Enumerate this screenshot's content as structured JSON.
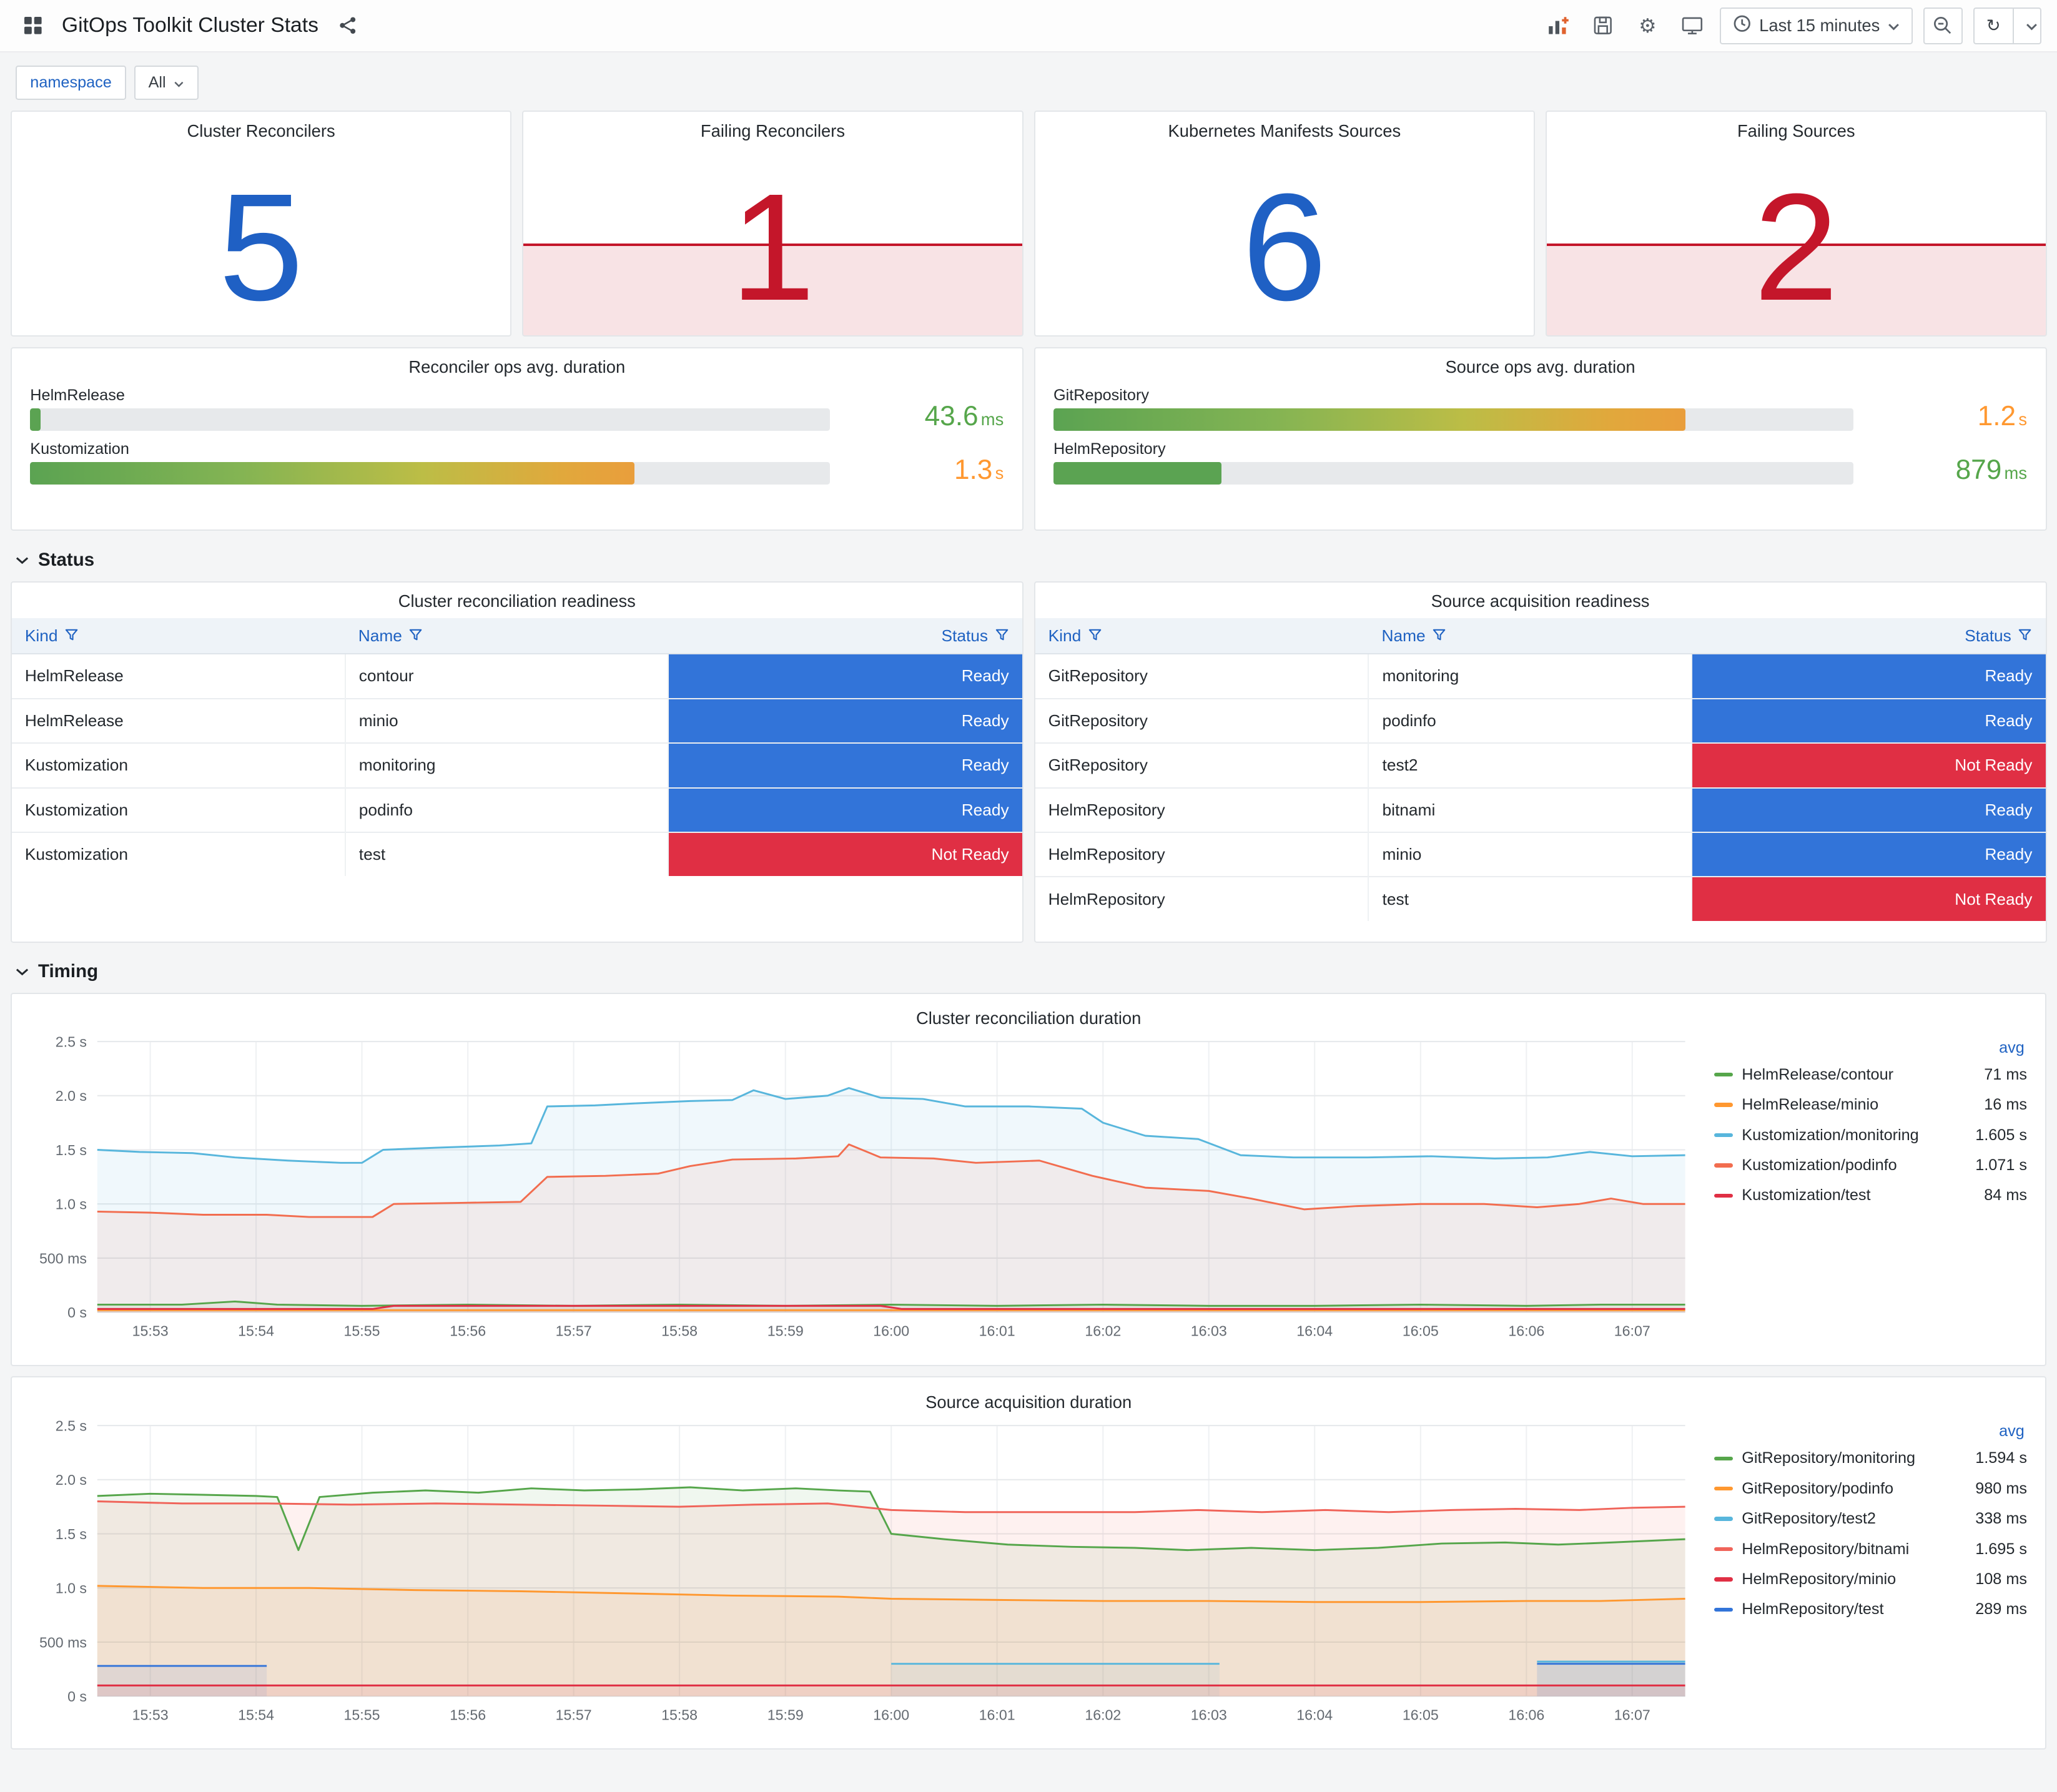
{
  "header": {
    "title": "GitOps Toolkit Cluster Stats",
    "time_range": "Last 15 minutes"
  },
  "filters": {
    "namespace_label": "namespace",
    "namespace_value": "All"
  },
  "colors": {
    "stat_ok": "#1f60c4",
    "stat_alert": "#c4162a",
    "alert_fill": "rgba(196,22,42,0.12)",
    "status_ready": "#3274d9",
    "status_not_ready": "#e02f44",
    "value_green": "#56a64b",
    "value_orange": "#ff9830",
    "link_blue": "#1f62c2"
  },
  "stats": [
    {
      "title": "Cluster Reconcilers",
      "value": "5",
      "state": "ok"
    },
    {
      "title": "Failing Reconcilers",
      "value": "1",
      "state": "alert"
    },
    {
      "title": "Kubernetes Manifests Sources",
      "value": "6",
      "state": "ok"
    },
    {
      "title": "Failing Sources",
      "value": "2",
      "state": "alert"
    }
  ],
  "gauges": [
    {
      "title": "Reconciler ops avg. duration",
      "rows": [
        {
          "label": "HelmRelease",
          "value": "43.6",
          "unit": "ms",
          "pct": 1.3,
          "fill": "green",
          "value_color": "green"
        },
        {
          "label": "Kustomization",
          "value": "1.3",
          "unit": "s",
          "pct": 75.5,
          "fill": "gradient",
          "value_color": "orange"
        }
      ]
    },
    {
      "title": "Source ops avg. duration",
      "rows": [
        {
          "label": "GitRepository",
          "value": "1.2",
          "unit": "s",
          "pct": 79,
          "fill": "gradient",
          "value_color": "orange"
        },
        {
          "label": "HelmRepository",
          "value": "879",
          "unit": "ms",
          "pct": 21,
          "fill": "green",
          "value_color": "green"
        }
      ]
    }
  ],
  "sections": {
    "status": "Status",
    "timing": "Timing"
  },
  "status_tables": [
    {
      "title": "Cluster reconciliation readiness",
      "columns": [
        "Kind",
        "Name",
        "Status"
      ],
      "rows": [
        [
          "HelmRelease",
          "contour",
          "Ready"
        ],
        [
          "HelmRelease",
          "minio",
          "Ready"
        ],
        [
          "Kustomization",
          "monitoring",
          "Ready"
        ],
        [
          "Kustomization",
          "podinfo",
          "Ready"
        ],
        [
          "Kustomization",
          "test",
          "Not Ready"
        ]
      ]
    },
    {
      "title": "Source acquisition readiness",
      "columns": [
        "Kind",
        "Name",
        "Status"
      ],
      "rows": [
        [
          "GitRepository",
          "monitoring",
          "Ready"
        ],
        [
          "GitRepository",
          "podinfo",
          "Ready"
        ],
        [
          "GitRepository",
          "test2",
          "Not Ready"
        ],
        [
          "HelmRepository",
          "bitnami",
          "Ready"
        ],
        [
          "HelmRepository",
          "minio",
          "Ready"
        ],
        [
          "HelmRepository",
          "test",
          "Not Ready"
        ]
      ]
    }
  ],
  "charts": [
    {
      "type": "line",
      "title": "Cluster reconciliation duration",
      "legend_header": "avg",
      "x_range": [
        0,
        15
      ],
      "y_range": [
        0,
        2.5
      ],
      "x_labels": [
        "15:53",
        "15:54",
        "15:55",
        "15:56",
        "15:57",
        "15:58",
        "15:59",
        "16:00",
        "16:01",
        "16:02",
        "16:03",
        "16:04",
        "16:05",
        "16:06",
        "16:07"
      ],
      "y_ticks": [
        {
          "v": 0,
          "label": "0 s"
        },
        {
          "v": 0.5,
          "label": "500 ms"
        },
        {
          "v": 1,
          "label": "1.0 s"
        },
        {
          "v": 1.5,
          "label": "1.5 s"
        },
        {
          "v": 2,
          "label": "2.0 s"
        },
        {
          "v": 2.5,
          "label": "2.5 s"
        }
      ],
      "series": [
        {
          "name": "HelmRelease/contour",
          "color": "#56a64b",
          "avg": "71 ms",
          "points": [
            [
              0,
              0.07
            ],
            [
              0.8,
              0.07
            ],
            [
              1.3,
              0.1
            ],
            [
              1.7,
              0.07
            ],
            [
              2.5,
              0.06
            ],
            [
              3.5,
              0.07
            ],
            [
              4.5,
              0.06
            ],
            [
              5.5,
              0.07
            ],
            [
              6.5,
              0.06
            ],
            [
              7.5,
              0.07
            ],
            [
              8.5,
              0.06
            ],
            [
              9.5,
              0.07
            ],
            [
              10.5,
              0.06
            ],
            [
              11.5,
              0.06
            ],
            [
              12.5,
              0.07
            ],
            [
              13.5,
              0.06
            ],
            [
              14.2,
              0.07
            ],
            [
              15,
              0.07
            ]
          ]
        },
        {
          "name": "HelmRelease/minio",
          "color": "#ff9830",
          "avg": "16 ms",
          "points": [
            [
              0,
              0.02
            ],
            [
              5,
              0.02
            ],
            [
              10,
              0.02
            ],
            [
              15,
              0.02
            ]
          ]
        },
        {
          "name": "Kustomization/monitoring",
          "color": "#58b6dc",
          "avg": "1.605 s",
          "points": [
            [
              0,
              1.5
            ],
            [
              0.4,
              1.48
            ],
            [
              0.9,
              1.47
            ],
            [
              1.3,
              1.43
            ],
            [
              1.8,
              1.4
            ],
            [
              2.3,
              1.38
            ],
            [
              2.5,
              1.38
            ],
            [
              2.7,
              1.5
            ],
            [
              3.2,
              1.52
            ],
            [
              3.8,
              1.54
            ],
            [
              4.1,
              1.56
            ],
            [
              4.25,
              1.9
            ],
            [
              4.7,
              1.91
            ],
            [
              5.1,
              1.93
            ],
            [
              5.6,
              1.95
            ],
            [
              6,
              1.96
            ],
            [
              6.2,
              2.05
            ],
            [
              6.5,
              1.97
            ],
            [
              6.9,
              2.0
            ],
            [
              7.1,
              2.07
            ],
            [
              7.4,
              1.98
            ],
            [
              7.8,
              1.97
            ],
            [
              8.2,
              1.9
            ],
            [
              8.8,
              1.9
            ],
            [
              9.3,
              1.88
            ],
            [
              9.5,
              1.75
            ],
            [
              9.9,
              1.63
            ],
            [
              10.4,
              1.6
            ],
            [
              10.8,
              1.45
            ],
            [
              11.3,
              1.43
            ],
            [
              12,
              1.43
            ],
            [
              12.6,
              1.44
            ],
            [
              13.2,
              1.42
            ],
            [
              13.7,
              1.43
            ],
            [
              14.1,
              1.48
            ],
            [
              14.5,
              1.44
            ],
            [
              15,
              1.45
            ]
          ]
        },
        {
          "name": "Kustomization/podinfo",
          "color": "#f26d4f",
          "avg": "1.071 s",
          "points": [
            [
              0,
              0.93
            ],
            [
              0.5,
              0.92
            ],
            [
              1,
              0.9
            ],
            [
              1.6,
              0.9
            ],
            [
              2,
              0.88
            ],
            [
              2.6,
              0.88
            ],
            [
              2.8,
              1.0
            ],
            [
              3.4,
              1.01
            ],
            [
              4,
              1.02
            ],
            [
              4.25,
              1.25
            ],
            [
              4.8,
              1.26
            ],
            [
              5.3,
              1.28
            ],
            [
              5.6,
              1.35
            ],
            [
              6,
              1.41
            ],
            [
              6.6,
              1.42
            ],
            [
              7,
              1.44
            ],
            [
              7.1,
              1.55
            ],
            [
              7.4,
              1.43
            ],
            [
              7.9,
              1.42
            ],
            [
              8.3,
              1.38
            ],
            [
              8.9,
              1.4
            ],
            [
              9.4,
              1.26
            ],
            [
              9.9,
              1.15
            ],
            [
              10.5,
              1.12
            ],
            [
              10.9,
              1.05
            ],
            [
              11.4,
              0.95
            ],
            [
              11.9,
              0.98
            ],
            [
              12.5,
              1.0
            ],
            [
              13.1,
              1.0
            ],
            [
              13.6,
              0.97
            ],
            [
              14,
              1.0
            ],
            [
              14.3,
              1.05
            ],
            [
              14.6,
              1.0
            ],
            [
              15,
              1.0
            ]
          ]
        },
        {
          "name": "Kustomization/test",
          "color": "#e02f44",
          "avg": "84 ms",
          "points": [
            [
              0,
              0.03
            ],
            [
              2.6,
              0.03
            ],
            [
              2.8,
              0.06
            ],
            [
              7.4,
              0.06
            ],
            [
              7.6,
              0.03
            ],
            [
              15,
              0.03
            ]
          ]
        }
      ]
    },
    {
      "type": "line",
      "title": "Source acquisition duration",
      "legend_header": "avg",
      "x_range": [
        0,
        15
      ],
      "y_range": [
        0,
        2.5
      ],
      "x_labels": [
        "15:53",
        "15:54",
        "15:55",
        "15:56",
        "15:57",
        "15:58",
        "15:59",
        "16:00",
        "16:01",
        "16:02",
        "16:03",
        "16:04",
        "16:05",
        "16:06",
        "16:07"
      ],
      "y_ticks": [
        {
          "v": 0,
          "label": "0 s"
        },
        {
          "v": 0.5,
          "label": "500 ms"
        },
        {
          "v": 1,
          "label": "1.0 s"
        },
        {
          "v": 1.5,
          "label": "1.5 s"
        },
        {
          "v": 2,
          "label": "2.0 s"
        },
        {
          "v": 2.5,
          "label": "2.5 s"
        }
      ],
      "series": [
        {
          "name": "GitRepository/monitoring",
          "color": "#56a64b",
          "avg": "1.594 s",
          "points": [
            [
              0,
              1.85
            ],
            [
              0.5,
              1.87
            ],
            [
              1,
              1.86
            ],
            [
              1.5,
              1.85
            ],
            [
              1.7,
              1.84
            ],
            [
              1.9,
              1.35
            ],
            [
              2.1,
              1.84
            ],
            [
              2.6,
              1.88
            ],
            [
              3.1,
              1.9
            ],
            [
              3.6,
              1.88
            ],
            [
              4.1,
              1.92
            ],
            [
              4.6,
              1.9
            ],
            [
              5.1,
              1.91
            ],
            [
              5.6,
              1.93
            ],
            [
              6.1,
              1.9
            ],
            [
              6.6,
              1.92
            ],
            [
              7,
              1.9
            ],
            [
              7.3,
              1.89
            ],
            [
              7.5,
              1.5
            ],
            [
              8,
              1.45
            ],
            [
              8.6,
              1.4
            ],
            [
              9.2,
              1.38
            ],
            [
              9.8,
              1.37
            ],
            [
              10.3,
              1.35
            ],
            [
              10.9,
              1.37
            ],
            [
              11.5,
              1.35
            ],
            [
              12.1,
              1.37
            ],
            [
              12.7,
              1.41
            ],
            [
              13.3,
              1.42
            ],
            [
              13.8,
              1.4
            ],
            [
              14.3,
              1.42
            ],
            [
              15,
              1.45
            ]
          ]
        },
        {
          "name": "GitRepository/podinfo",
          "color": "#ff9830",
          "avg": "980 ms",
          "points": [
            [
              0,
              1.02
            ],
            [
              1,
              1.0
            ],
            [
              2,
              1.0
            ],
            [
              3,
              0.98
            ],
            [
              4,
              0.97
            ],
            [
              5,
              0.95
            ],
            [
              6,
              0.93
            ],
            [
              7,
              0.92
            ],
            [
              7.5,
              0.9
            ],
            [
              8.5,
              0.89
            ],
            [
              9.5,
              0.88
            ],
            [
              10.5,
              0.88
            ],
            [
              11.5,
              0.87
            ],
            [
              12.5,
              0.87
            ],
            [
              13.5,
              0.88
            ],
            [
              14.2,
              0.88
            ],
            [
              15,
              0.9
            ]
          ]
        },
        {
          "name": "GitRepository/test2",
          "color": "#58b6dc",
          "avg": "338 ms",
          "points": [
            [
              7.5,
              0.3
            ],
            [
              8.5,
              0.3
            ],
            [
              9.5,
              0.3
            ],
            [
              10.6,
              0.3
            ],
            [
              10.7,
              null
            ],
            [
              13.6,
              0.32
            ],
            [
              14.3,
              0.32
            ],
            [
              15,
              0.32
            ]
          ]
        },
        {
          "name": "HelmRepository/bitnami",
          "color": "#f0645a",
          "avg": "1.695 s",
          "points": [
            [
              0,
              1.8
            ],
            [
              0.8,
              1.78
            ],
            [
              1.6,
              1.78
            ],
            [
              2.4,
              1.77
            ],
            [
              3.2,
              1.78
            ],
            [
              4,
              1.77
            ],
            [
              4.8,
              1.76
            ],
            [
              5.5,
              1.75
            ],
            [
              6.2,
              1.77
            ],
            [
              6.9,
              1.78
            ],
            [
              7.5,
              1.72
            ],
            [
              8.2,
              1.7
            ],
            [
              9,
              1.7
            ],
            [
              9.8,
              1.7
            ],
            [
              10.4,
              1.72
            ],
            [
              11,
              1.7
            ],
            [
              11.6,
              1.72
            ],
            [
              12.2,
              1.7
            ],
            [
              12.8,
              1.72
            ],
            [
              13.4,
              1.73
            ],
            [
              14,
              1.72
            ],
            [
              14.5,
              1.74
            ],
            [
              15,
              1.75
            ]
          ]
        },
        {
          "name": "HelmRepository/minio",
          "color": "#e02f44",
          "avg": "108 ms",
          "points": [
            [
              0,
              0.1
            ],
            [
              5,
              0.1
            ],
            [
              10,
              0.1
            ],
            [
              15,
              0.1
            ]
          ]
        },
        {
          "name": "HelmRepository/test",
          "color": "#3274d9",
          "avg": "289 ms",
          "points": [
            [
              0,
              0.28
            ],
            [
              0.8,
              0.28
            ],
            [
              1.6,
              0.28
            ],
            [
              1.7,
              null
            ],
            [
              13.6,
              0.3
            ],
            [
              14.3,
              0.3
            ],
            [
              15,
              0.3
            ]
          ]
        }
      ]
    }
  ]
}
